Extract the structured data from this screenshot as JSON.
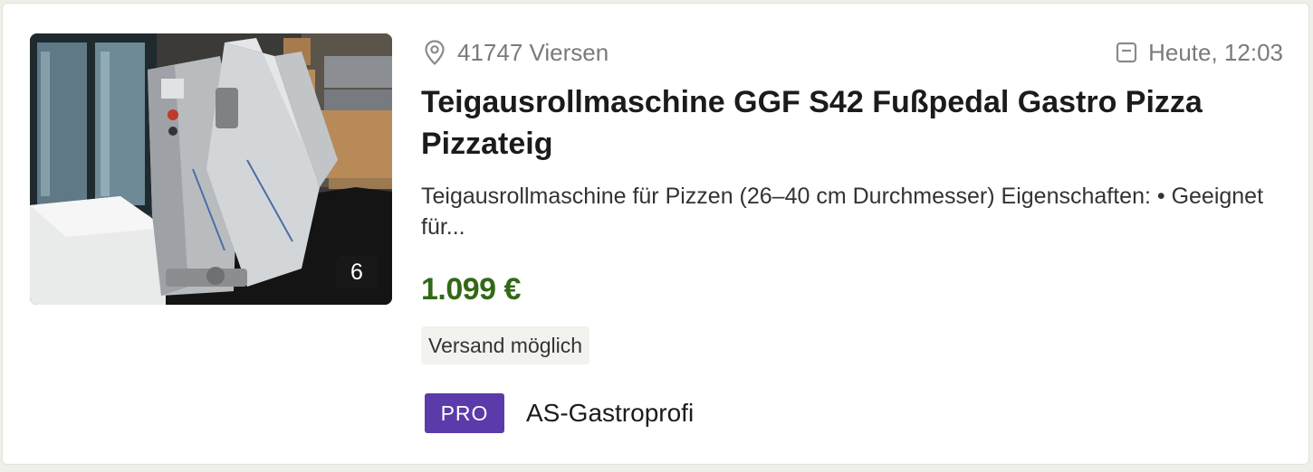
{
  "listing": {
    "image": {
      "alt": "",
      "count": "6"
    },
    "location": {
      "icon": "location-pin-icon",
      "text": "41747 Viersen"
    },
    "date": {
      "icon": "calendar-icon",
      "text": "Heute, 12:03"
    },
    "title": "Teigausrollmaschine GGF S42 Fußpedal Gastro Pizza Pizzateig",
    "description": "Teigausrollmaschine für Pizzen (26–40 cm Durchmesser) Eigenschaften: • Geeignet für...",
    "price": "1.099 €",
    "shipping_tag": "Versand möglich",
    "seller": {
      "badge": "PRO",
      "name": "AS-Gastroprofi"
    }
  },
  "colors": {
    "price": "#326916",
    "pro_badge": "#5b3aaa",
    "meta_text": "#7a7a7a",
    "tag_bg": "#f2f2ee"
  }
}
